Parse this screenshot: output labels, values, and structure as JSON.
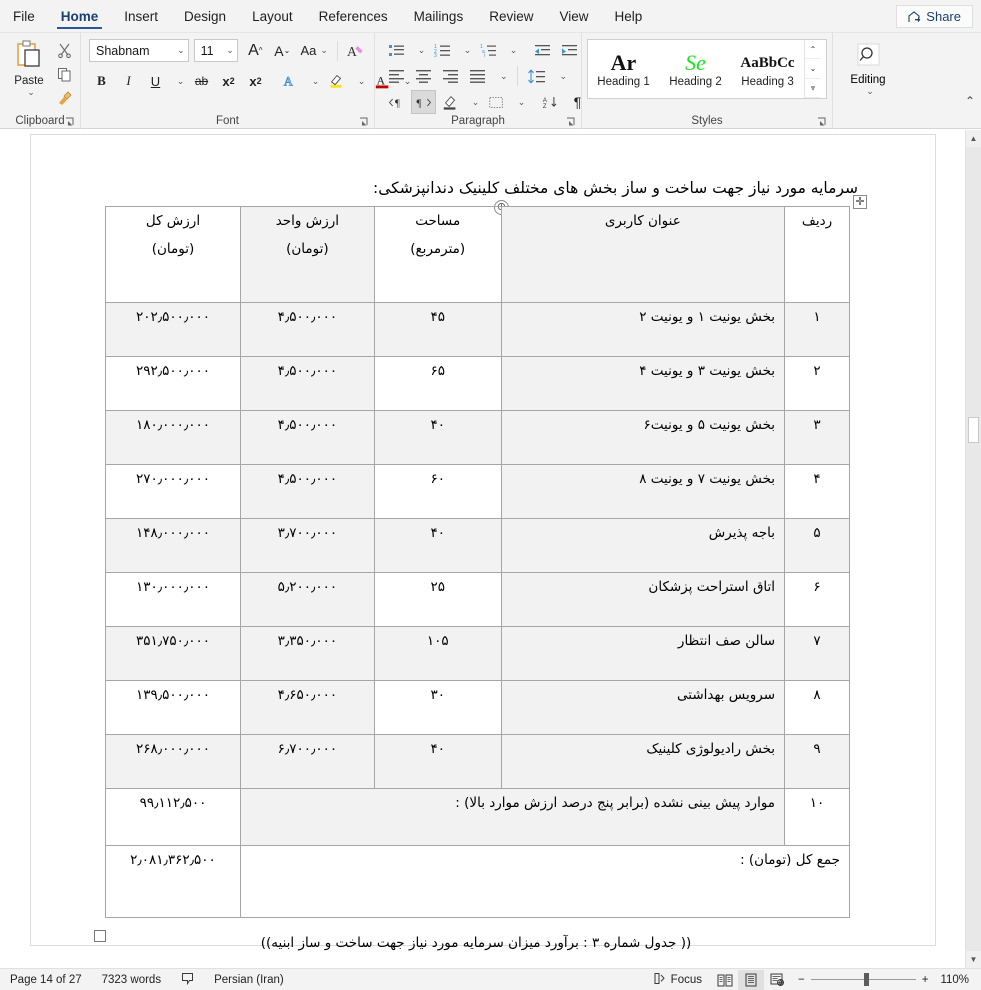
{
  "ribbon": {
    "tabs": [
      {
        "label": "File",
        "active": false
      },
      {
        "label": "Home",
        "active": true
      },
      {
        "label": "Insert",
        "active": false
      },
      {
        "label": "Design",
        "active": false
      },
      {
        "label": "Layout",
        "active": false
      },
      {
        "label": "References",
        "active": false
      },
      {
        "label": "Mailings",
        "active": false
      },
      {
        "label": "Review",
        "active": false
      },
      {
        "label": "View",
        "active": false
      },
      {
        "label": "Help",
        "active": false
      }
    ],
    "share_label": "Share",
    "groups": {
      "clipboard": {
        "label": "Clipboard",
        "paste_label": "Paste",
        "cut_icon": "scissors-icon",
        "copy_icon": "copy-icon",
        "format_painter_icon": "format-painter-icon"
      },
      "font": {
        "label": "Font",
        "font_name": "Shabnam",
        "font_size": "11",
        "grow_font": "A",
        "shrink_font": "A",
        "change_case": "Aa",
        "clear_formatting": "A",
        "bold": "B",
        "italic": "I",
        "underline": "U",
        "strikethrough": "ab",
        "subscript": "x",
        "superscript": "x",
        "text_effects": "A",
        "highlight": "A",
        "font_color": "A"
      },
      "paragraph": {
        "label": "Paragraph",
        "bullets": "bullets-icon",
        "numbering": "numbering-icon",
        "multilevel": "multilevel-list-icon",
        "decrease_indent": "decrease-indent-icon",
        "increase_indent": "increase-indent-icon",
        "align_left": "align-left-icon",
        "align_center": "align-center-icon",
        "align_right": "align-right-icon",
        "justify": "justify-icon",
        "line_spacing": "line-spacing-icon",
        "ltr": "ltr-text-direction-icon",
        "rtl": "rtl-text-direction-icon",
        "shading": "shading-icon",
        "borders": "borders-icon",
        "sort": "sort-icon",
        "show_marks": "paragraph-marks-icon"
      },
      "styles": {
        "label": "Styles",
        "items": [
          {
            "preview": "Ar",
            "name": "Heading 1"
          },
          {
            "preview": "Se",
            "name": "Heading 2"
          },
          {
            "preview": "AaBbCc",
            "name": "Heading 3"
          }
        ]
      },
      "editing": {
        "label": "Editing",
        "button": "Editing",
        "icon": "search-icon"
      }
    }
  },
  "document": {
    "title": "سرمایه مورد نیاز جهت ساخت و ساز بخش های مختلف کلینیک دندانپزشکی:",
    "caption": "(( جدول شماره ۳ : برآورد میزان سرمایه مورد نیاز جهت ساخت و ساز ابنیه))",
    "table": {
      "headers": {
        "radif": "ردیف",
        "title": "عنوان کاربری",
        "area_line1": "مساحت",
        "area_line2": "(مترمربع)",
        "unit_line1": "ارزش واحد",
        "unit_line2": "(تومان)",
        "total_line1": "ارزش کل",
        "total_line2": "(تومان)"
      },
      "rows": [
        {
          "radif": "۱",
          "title": "بخش یونیت ۱ و یونیت ۲",
          "area": "۴۵",
          "unit": "۴٫۵۰۰٫۰۰۰",
          "total": "۲۰۲٫۵۰۰٫۰۰۰"
        },
        {
          "radif": "۲",
          "title": "بخش یونیت ۳ و یونیت ۴",
          "area": "۶۵",
          "unit": "۴٫۵۰۰٫۰۰۰",
          "total": "۲۹۲٫۵۰۰٫۰۰۰"
        },
        {
          "radif": "۳",
          "title": "بخش یونیت ۵ و یونیت۶",
          "area": "۴۰",
          "unit": "۴٫۵۰۰٫۰۰۰",
          "total": "۱۸۰٫۰۰۰٫۰۰۰"
        },
        {
          "radif": "۴",
          "title": "بخش یونیت ۷ و یونیت ۸",
          "area": "۶۰",
          "unit": "۴٫۵۰۰٫۰۰۰",
          "total": "۲۷۰٫۰۰۰٫۰۰۰"
        },
        {
          "radif": "۵",
          "title": "باجه پذیرش",
          "area": "۴۰",
          "unit": "۳٫۷۰۰٫۰۰۰",
          "total": "۱۴۸٫۰۰۰٫۰۰۰"
        },
        {
          "radif": "۶",
          "title": "اتاق استراحت پزشکان",
          "area": "۲۵",
          "unit": "۵٫۲۰۰٫۰۰۰",
          "total": "۱۳۰٫۰۰۰٫۰۰۰"
        },
        {
          "radif": "۷",
          "title": "سالن صف انتظار",
          "area": "۱۰۵",
          "unit": "۳٫۳۵۰٫۰۰۰",
          "total": "۳۵۱٫۷۵۰٫۰۰۰"
        },
        {
          "radif": "۸",
          "title": "سرویس بهداشتی",
          "area": "۳۰",
          "unit": "۴٫۶۵۰٫۰۰۰",
          "total": "۱۳۹٫۵۰۰٫۰۰۰"
        },
        {
          "radif": "۹",
          "title": "بخش رادیولوژی کلینیک",
          "area": "۴۰",
          "unit": "۶٫۷۰۰٫۰۰۰",
          "total": "۲۶۸٫۰۰۰٫۰۰۰"
        }
      ],
      "row10": {
        "radif": "۱۰",
        "note": "موارد پیش بینی نشده (برابر پنج درصد ارزش موارد بالا) :",
        "total": "۹۹٫۱۱۲٫۵۰۰"
      },
      "total_row": {
        "label": "جمع کل (تومان) :",
        "value": "۲٫۰۸۱٫۳۶۲٫۵۰۰"
      }
    }
  },
  "statusbar": {
    "page": "Page 14 of 27",
    "words": "7323 words",
    "proofing_icon": "proofing-errors-icon",
    "language": "Persian (Iran)",
    "focus": "Focus",
    "views": [
      {
        "name": "read-mode",
        "icon": "book-icon",
        "active": false
      },
      {
        "name": "print-layout",
        "icon": "page-icon",
        "active": true
      },
      {
        "name": "web-layout",
        "icon": "web-icon",
        "active": false
      }
    ],
    "zoom_out": "−",
    "zoom_in": "+",
    "zoom_level": "110%"
  }
}
